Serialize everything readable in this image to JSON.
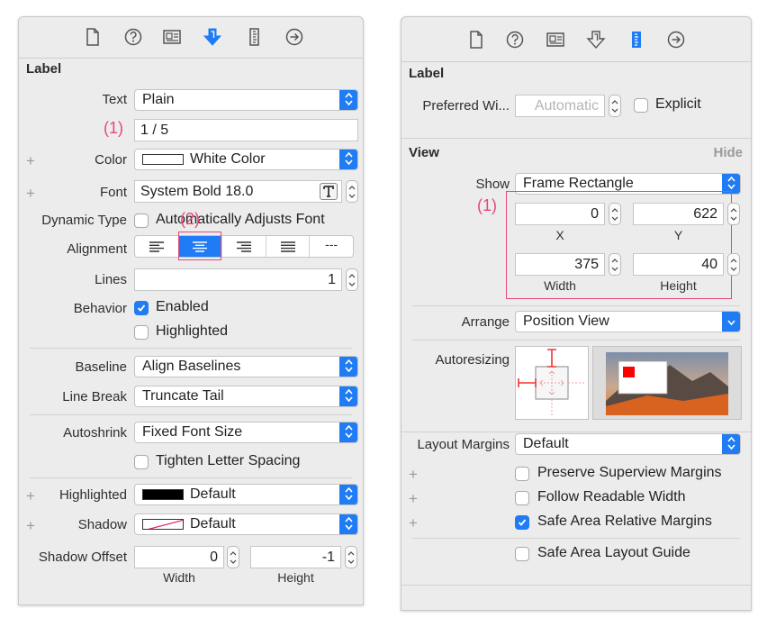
{
  "colors": {
    "accent": "#1f7cf4",
    "annotation": "#e6477a"
  },
  "toolbar_icons": [
    "file-icon",
    "help-icon",
    "identity-icon",
    "attributes-icon",
    "size-icon",
    "connections-icon"
  ],
  "left": {
    "section_title": "Label",
    "text_label": "Text",
    "text_value": "Plain",
    "annotation_1": "(1)",
    "text_field_value": "1 / 5",
    "color_label": "Color",
    "color_value": "White Color",
    "font_label": "Font",
    "font_value": "System Bold 18.0",
    "dynamic_type_label": "Dynamic Type",
    "dynamic_type_value": "Automatically Adjusts Font",
    "annotation_2": "(2)",
    "alignment_label": "Alignment",
    "alignment_options": [
      "left",
      "center",
      "right",
      "justified",
      "natural"
    ],
    "alignment_selected": "center",
    "natural_glyph": "---",
    "lines_label": "Lines",
    "lines_value": "1",
    "behavior_label": "Behavior",
    "enabled_label": "Enabled",
    "highlighted_check_label": "Highlighted",
    "baseline_label": "Baseline",
    "baseline_value": "Align Baselines",
    "line_break_label": "Line Break",
    "line_break_value": "Truncate Tail",
    "autoshrink_label": "Autoshrink",
    "autoshrink_value": "Fixed Font Size",
    "tighten_label": "Tighten Letter Spacing",
    "highlighted_label": "Highlighted",
    "highlighted_value": "Default",
    "shadow_label": "Shadow",
    "shadow_value": "Default",
    "shadow_offset_label": "Shadow Offset",
    "shadow_width_value": "0",
    "shadow_height_value": "-1",
    "width_label": "Width",
    "height_label": "Height"
  },
  "right": {
    "label_section_title": "Label",
    "preferred_width_label": "Preferred Wi...",
    "preferred_width_placeholder": "Automatic",
    "explicit_label": "Explicit",
    "view_section_title": "View",
    "hide_label": "Hide",
    "show_label": "Show",
    "show_value": "Frame Rectangle",
    "annotation_1": "(1)",
    "x_value": "0",
    "y_value": "622",
    "x_label": "X",
    "y_label": "Y",
    "width_value": "375",
    "height_value": "40",
    "width_label": "Width",
    "height_label": "Height",
    "arrange_label": "Arrange",
    "arrange_value": "Position View",
    "autoresizing_label": "Autoresizing",
    "layout_margins_label": "Layout Margins",
    "layout_margins_value": "Default",
    "preserve_label": "Preserve Superview Margins",
    "follow_label": "Follow Readable Width",
    "safe_area_margins_label": "Safe Area Relative Margins",
    "safe_area_guide_label": "Safe Area Layout Guide"
  }
}
